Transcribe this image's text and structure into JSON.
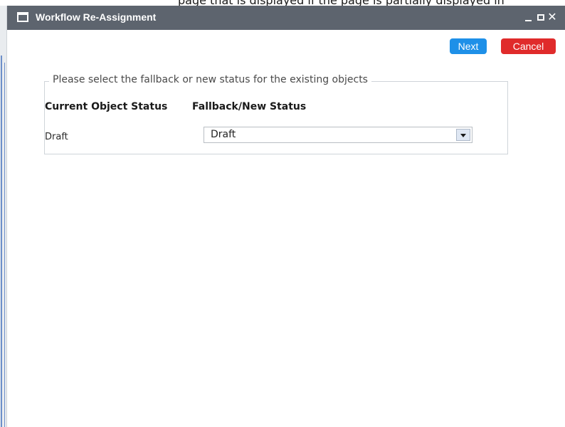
{
  "behind": {
    "partial_text": "page that is displayed if the page is partially displayed in"
  },
  "dialog": {
    "title": "Workflow Re-Assignment",
    "controls": {
      "minimize": "_",
      "maximize": "□",
      "close": "✕"
    }
  },
  "toolbar": {
    "next_label": "Next",
    "cancel_label": "Cancel"
  },
  "form": {
    "legend": "Please select the fallback or new status for the existing objects",
    "columns": {
      "current": "Current Object Status",
      "fallback": "Fallback/New Status"
    },
    "rows": [
      {
        "current_status": "Draft",
        "fallback_status": "Draft"
      }
    ]
  },
  "colors": {
    "titlebar": "#5d646e",
    "next_button": "#1e90e8",
    "cancel_button": "#e02b2b"
  },
  "icons": {
    "title_icon": "window-icon",
    "dropdown_icon": "chevron-down-icon"
  }
}
